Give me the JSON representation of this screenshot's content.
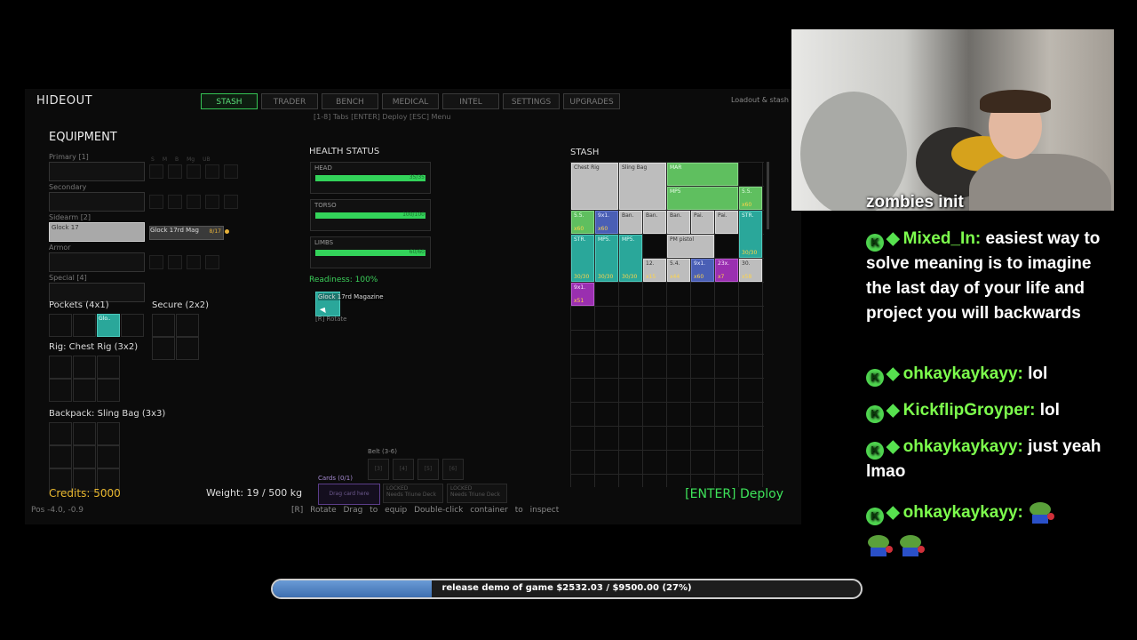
{
  "game": {
    "title": "HIDEOUT",
    "tabs": [
      "STASH",
      "TRADER",
      "BENCH",
      "MEDICAL",
      "INTEL",
      "SETTINGS",
      "UPGRADES"
    ],
    "active_tab": "STASH",
    "top_hint": "[1-8] Tabs [ENTER] Deploy [ESC] Menu",
    "loadout_label": "Loadout & stash",
    "equipment": {
      "title": "EQUIPMENT",
      "primary_label": "Primary [1]",
      "secondary_label": "Secondary",
      "sidearm_label": "Sidearm [2]",
      "sidearm_item": "Glock 17",
      "sidearm_mag": "Glock 17rd Mag",
      "sidearm_mag_count": "8/17",
      "armor_label": "Armor",
      "special_label": "Special [4]",
      "mod_labels": [
        "S",
        "M",
        "B",
        "Mg",
        "UB"
      ],
      "pockets_label": "Pockets (4x1)",
      "pocket_item": "Glo..",
      "secure_label": "Secure (2x2)",
      "rig_label": "Rig: Chest Rig (3x2)",
      "backpack_label": "Backpack: Sling Bag (3x3)"
    },
    "health": {
      "title": "HEALTH STATUS",
      "parts": [
        {
          "name": "HEAD",
          "value": "35/35"
        },
        {
          "name": "TORSO",
          "value": "100/100"
        },
        {
          "name": "LIMBS",
          "value": "60/60"
        }
      ],
      "readiness": "Readiness: 100%",
      "held_item": "Glock 17rd Magazine",
      "rotate_hint": "[R] Rotate"
    },
    "belt": {
      "label": "Belt (3-6)",
      "slots": [
        "[3]",
        "[4]",
        "[5]",
        "[6]"
      ]
    },
    "cards": {
      "label": "Cards (0/1)",
      "drop": "Drag card here",
      "locked1": "LOCKED",
      "locked1_sub": "Needs Triune Deck",
      "locked2": "LOCKED",
      "locked2_sub": "Needs Triune Deck"
    },
    "stash": {
      "title": "STASH",
      "items": [
        {
          "label": "Chest Rig",
          "cls": "sg",
          "col": 0,
          "row": 0,
          "w": 2,
          "h": 2
        },
        {
          "label": "Sling Bag",
          "cls": "sg",
          "col": 2,
          "row": 0,
          "w": 2,
          "h": 2
        },
        {
          "label": "MAR",
          "cls": "sgr",
          "col": 4,
          "row": 0,
          "w": 3,
          "h": 1
        },
        {
          "label": "MP5",
          "cls": "sgr",
          "col": 4,
          "row": 1,
          "w": 3,
          "h": 1
        },
        {
          "label": "5.5.",
          "cls": "sgr",
          "col": 7,
          "row": 1,
          "w": 1,
          "h": 1,
          "count": "x60"
        },
        {
          "label": "5.5.",
          "cls": "sgr",
          "col": 0,
          "row": 2,
          "w": 1,
          "h": 1,
          "count": "x60"
        },
        {
          "label": "9x1.",
          "cls": "sb",
          "col": 1,
          "row": 2,
          "w": 1,
          "h": 1,
          "count": "x60"
        },
        {
          "label": "Ban.",
          "cls": "sg",
          "col": 2,
          "row": 2,
          "w": 1,
          "h": 1
        },
        {
          "label": "Ban.",
          "cls": "sg",
          "col": 3,
          "row": 2,
          "w": 1,
          "h": 1
        },
        {
          "label": "Ban.",
          "cls": "sg",
          "col": 4,
          "row": 2,
          "w": 1,
          "h": 1
        },
        {
          "label": "Pai.",
          "cls": "sg",
          "col": 5,
          "row": 2,
          "w": 1,
          "h": 1
        },
        {
          "label": "Pai.",
          "cls": "sg",
          "col": 6,
          "row": 2,
          "w": 1,
          "h": 1
        },
        {
          "label": "STR.",
          "cls": "st",
          "col": 7,
          "row": 2,
          "w": 1,
          "h": 2,
          "count": "30/30"
        },
        {
          "label": "STR.",
          "cls": "st",
          "col": 0,
          "row": 3,
          "w": 1,
          "h": 2,
          "count": "30/30"
        },
        {
          "label": "MP5.",
          "cls": "st",
          "col": 1,
          "row": 3,
          "w": 1,
          "h": 2,
          "count": "30/30"
        },
        {
          "label": "MP5.",
          "cls": "st",
          "col": 2,
          "row": 3,
          "w": 1,
          "h": 2,
          "count": "30/30"
        },
        {
          "label": "PM pistol",
          "cls": "sg",
          "col": 4,
          "row": 3,
          "w": 2,
          "h": 1
        },
        {
          "label": "12.",
          "cls": "sg",
          "col": 3,
          "row": 4,
          "w": 1,
          "h": 1,
          "count": "x15"
        },
        {
          "label": "5.4.",
          "cls": "sg",
          "col": 4,
          "row": 4,
          "w": 1,
          "h": 1,
          "count": "x44"
        },
        {
          "label": "9x1.",
          "cls": "sb",
          "col": 5,
          "row": 4,
          "w": 1,
          "h": 1,
          "count": "x60"
        },
        {
          "label": "23x.",
          "cls": "sp",
          "col": 6,
          "row": 4,
          "w": 1,
          "h": 1,
          "count": "x7"
        },
        {
          "label": "30.",
          "cls": "sg",
          "col": 7,
          "row": 4,
          "w": 1,
          "h": 1,
          "count": "x58"
        },
        {
          "label": "9x1.",
          "cls": "sp",
          "col": 0,
          "row": 5,
          "w": 1,
          "h": 1,
          "count": "x51"
        }
      ]
    },
    "credits": "Credits: 5000",
    "weight": "Weight: 19 / 500 kg",
    "deploy": "[ENTER] Deploy",
    "pos": "Pos -4.0, -0.9",
    "help": "[R] Rotate   Drag to equip   Double-click container to inspect"
  },
  "chat": [
    {
      "type": "text",
      "text": "zombies init"
    },
    {
      "type": "msg",
      "user": "Mixed_In:",
      "text": "easiest way to solve meaning is to imagine the last day of your life and project you will backwards"
    },
    {
      "type": "msg",
      "user": "ohkaykaykayy:",
      "text": "lol"
    },
    {
      "type": "msg",
      "user": "KickflipGroyper:",
      "text": "lol"
    },
    {
      "type": "msg",
      "user": "ohkaykaykayy:",
      "text": "just yeah lmao"
    },
    {
      "type": "msg",
      "user": "ohkaykaykayy:",
      "text": "",
      "emotes": 3
    }
  ],
  "goal": {
    "text": "release demo of game $2532.03 / $9500.00 (27%)",
    "progress": 0.27
  }
}
